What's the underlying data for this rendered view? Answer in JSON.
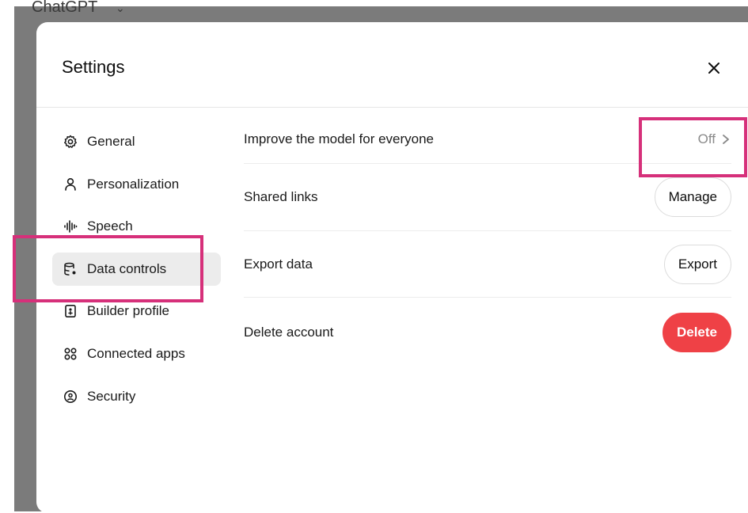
{
  "backdrop": {
    "app_title": "ChatGPT"
  },
  "modal": {
    "title": "Settings",
    "close_glyph": "✕"
  },
  "sidebar": {
    "items": [
      {
        "label": "General",
        "icon": "gear-icon",
        "active": false
      },
      {
        "label": "Personalization",
        "icon": "person-icon",
        "active": false
      },
      {
        "label": "Speech",
        "icon": "waveform-icon",
        "active": false
      },
      {
        "label": "Data controls",
        "icon": "database-gear-icon",
        "active": true
      },
      {
        "label": "Builder profile",
        "icon": "id-card-icon",
        "active": false
      },
      {
        "label": "Connected apps",
        "icon": "apps-grid-icon",
        "active": false
      },
      {
        "label": "Security",
        "icon": "shield-lock-icon",
        "active": false
      }
    ]
  },
  "content": {
    "rows": [
      {
        "label": "Improve the model for everyone",
        "control_type": "link",
        "value": "Off"
      },
      {
        "label": "Shared links",
        "control_type": "button",
        "value": "Manage"
      },
      {
        "label": "Export data",
        "control_type": "button",
        "value": "Export"
      },
      {
        "label": "Delete account",
        "control_type": "danger-button",
        "value": "Delete"
      }
    ]
  },
  "colors": {
    "highlight": "#d6307a",
    "danger": "#ef4146",
    "active_nav_bg": "#ececec"
  }
}
